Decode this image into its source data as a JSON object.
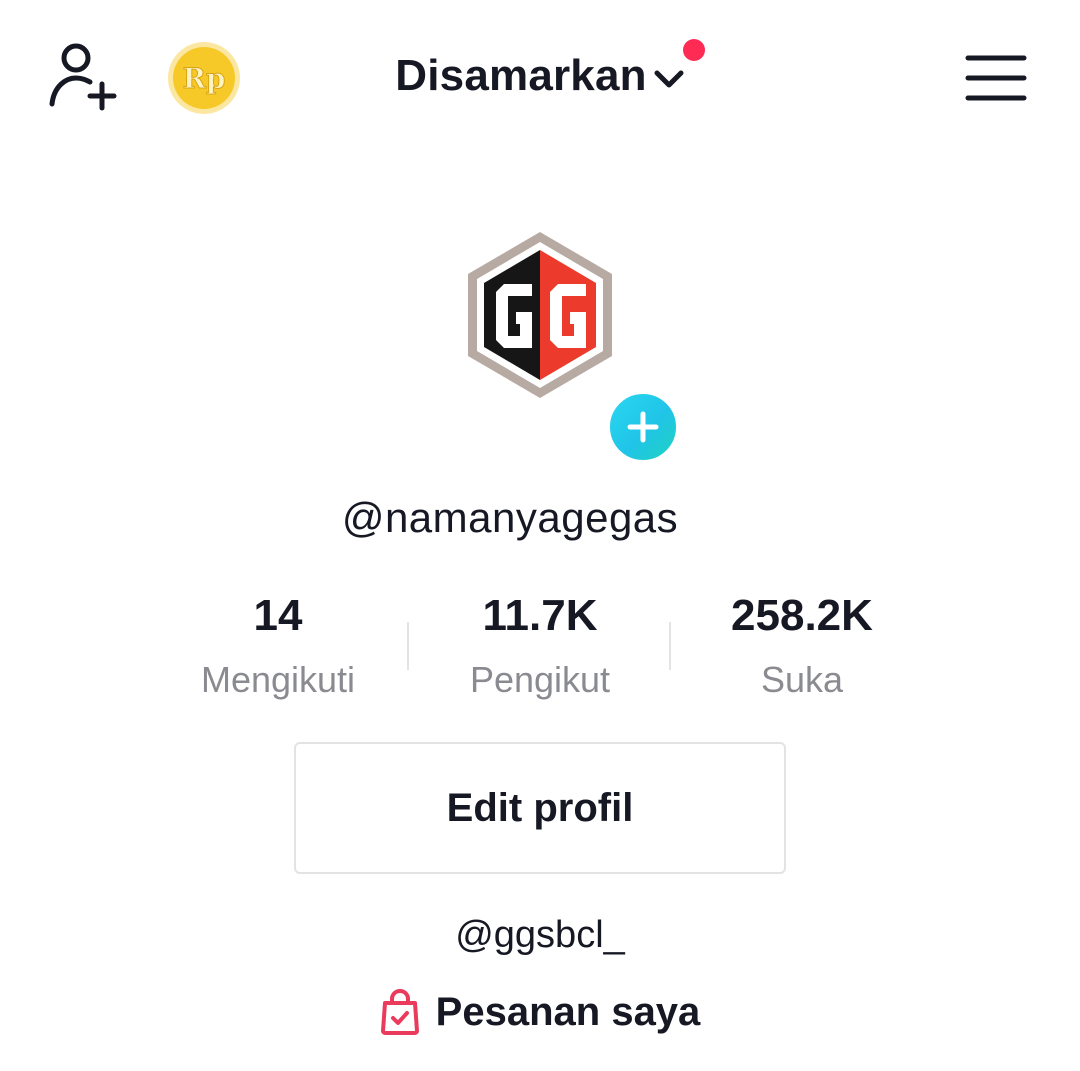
{
  "header": {
    "account_name": "Disamarkan",
    "coin_label": "Rp",
    "colors": {
      "notification_dot": "#fe2c55",
      "coin": "#f7c928"
    },
    "icons": [
      "add-user-icon",
      "coin-icon",
      "chevron-down-icon",
      "menu-icon"
    ]
  },
  "profile": {
    "avatar_text": "GG",
    "username": "@namanyagegas",
    "colors": {
      "add_button": "#20c4e8"
    }
  },
  "stats": [
    {
      "value": "14",
      "label": "Mengikuti"
    },
    {
      "value": "11.7K",
      "label": "Pengikut"
    },
    {
      "value": "258.2K",
      "label": "Suka"
    }
  ],
  "actions": {
    "edit_profile_label": "Edit profil"
  },
  "bio": {
    "link": "@ggsbcl_"
  },
  "orders": {
    "label": "Pesanan saya",
    "icon": "shopping-bag-icon",
    "icon_color": "#ea3b5c"
  }
}
